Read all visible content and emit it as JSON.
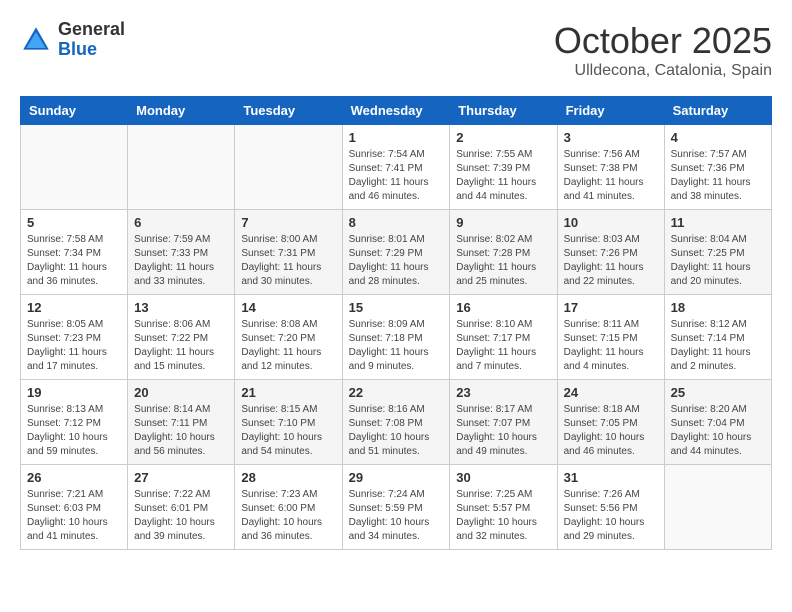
{
  "logo": {
    "general": "General",
    "blue": "Blue"
  },
  "header": {
    "month": "October 2025",
    "location": "Ulldecona, Catalonia, Spain"
  },
  "weekdays": [
    "Sunday",
    "Monday",
    "Tuesday",
    "Wednesday",
    "Thursday",
    "Friday",
    "Saturday"
  ],
  "weeks": [
    [
      {
        "day": "",
        "info": ""
      },
      {
        "day": "",
        "info": ""
      },
      {
        "day": "",
        "info": ""
      },
      {
        "day": "1",
        "info": "Sunrise: 7:54 AM\nSunset: 7:41 PM\nDaylight: 11 hours and 46 minutes."
      },
      {
        "day": "2",
        "info": "Sunrise: 7:55 AM\nSunset: 7:39 PM\nDaylight: 11 hours and 44 minutes."
      },
      {
        "day": "3",
        "info": "Sunrise: 7:56 AM\nSunset: 7:38 PM\nDaylight: 11 hours and 41 minutes."
      },
      {
        "day": "4",
        "info": "Sunrise: 7:57 AM\nSunset: 7:36 PM\nDaylight: 11 hours and 38 minutes."
      }
    ],
    [
      {
        "day": "5",
        "info": "Sunrise: 7:58 AM\nSunset: 7:34 PM\nDaylight: 11 hours and 36 minutes."
      },
      {
        "day": "6",
        "info": "Sunrise: 7:59 AM\nSunset: 7:33 PM\nDaylight: 11 hours and 33 minutes."
      },
      {
        "day": "7",
        "info": "Sunrise: 8:00 AM\nSunset: 7:31 PM\nDaylight: 11 hours and 30 minutes."
      },
      {
        "day": "8",
        "info": "Sunrise: 8:01 AM\nSunset: 7:29 PM\nDaylight: 11 hours and 28 minutes."
      },
      {
        "day": "9",
        "info": "Sunrise: 8:02 AM\nSunset: 7:28 PM\nDaylight: 11 hours and 25 minutes."
      },
      {
        "day": "10",
        "info": "Sunrise: 8:03 AM\nSunset: 7:26 PM\nDaylight: 11 hours and 22 minutes."
      },
      {
        "day": "11",
        "info": "Sunrise: 8:04 AM\nSunset: 7:25 PM\nDaylight: 11 hours and 20 minutes."
      }
    ],
    [
      {
        "day": "12",
        "info": "Sunrise: 8:05 AM\nSunset: 7:23 PM\nDaylight: 11 hours and 17 minutes."
      },
      {
        "day": "13",
        "info": "Sunrise: 8:06 AM\nSunset: 7:22 PM\nDaylight: 11 hours and 15 minutes."
      },
      {
        "day": "14",
        "info": "Sunrise: 8:08 AM\nSunset: 7:20 PM\nDaylight: 11 hours and 12 minutes."
      },
      {
        "day": "15",
        "info": "Sunrise: 8:09 AM\nSunset: 7:18 PM\nDaylight: 11 hours and 9 minutes."
      },
      {
        "day": "16",
        "info": "Sunrise: 8:10 AM\nSunset: 7:17 PM\nDaylight: 11 hours and 7 minutes."
      },
      {
        "day": "17",
        "info": "Sunrise: 8:11 AM\nSunset: 7:15 PM\nDaylight: 11 hours and 4 minutes."
      },
      {
        "day": "18",
        "info": "Sunrise: 8:12 AM\nSunset: 7:14 PM\nDaylight: 11 hours and 2 minutes."
      }
    ],
    [
      {
        "day": "19",
        "info": "Sunrise: 8:13 AM\nSunset: 7:12 PM\nDaylight: 10 hours and 59 minutes."
      },
      {
        "day": "20",
        "info": "Sunrise: 8:14 AM\nSunset: 7:11 PM\nDaylight: 10 hours and 56 minutes."
      },
      {
        "day": "21",
        "info": "Sunrise: 8:15 AM\nSunset: 7:10 PM\nDaylight: 10 hours and 54 minutes."
      },
      {
        "day": "22",
        "info": "Sunrise: 8:16 AM\nSunset: 7:08 PM\nDaylight: 10 hours and 51 minutes."
      },
      {
        "day": "23",
        "info": "Sunrise: 8:17 AM\nSunset: 7:07 PM\nDaylight: 10 hours and 49 minutes."
      },
      {
        "day": "24",
        "info": "Sunrise: 8:18 AM\nSunset: 7:05 PM\nDaylight: 10 hours and 46 minutes."
      },
      {
        "day": "25",
        "info": "Sunrise: 8:20 AM\nSunset: 7:04 PM\nDaylight: 10 hours and 44 minutes."
      }
    ],
    [
      {
        "day": "26",
        "info": "Sunrise: 7:21 AM\nSunset: 6:03 PM\nDaylight: 10 hours and 41 minutes."
      },
      {
        "day": "27",
        "info": "Sunrise: 7:22 AM\nSunset: 6:01 PM\nDaylight: 10 hours and 39 minutes."
      },
      {
        "day": "28",
        "info": "Sunrise: 7:23 AM\nSunset: 6:00 PM\nDaylight: 10 hours and 36 minutes."
      },
      {
        "day": "29",
        "info": "Sunrise: 7:24 AM\nSunset: 5:59 PM\nDaylight: 10 hours and 34 minutes."
      },
      {
        "day": "30",
        "info": "Sunrise: 7:25 AM\nSunset: 5:57 PM\nDaylight: 10 hours and 32 minutes."
      },
      {
        "day": "31",
        "info": "Sunrise: 7:26 AM\nSunset: 5:56 PM\nDaylight: 10 hours and 29 minutes."
      },
      {
        "day": "",
        "info": ""
      }
    ]
  ]
}
